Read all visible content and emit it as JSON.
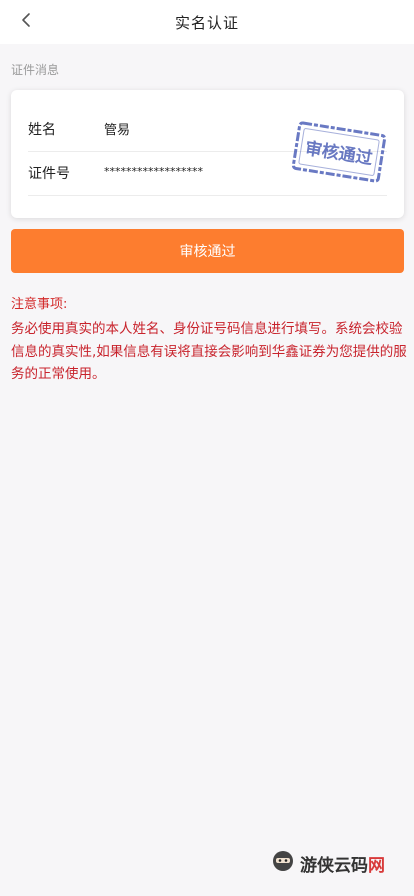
{
  "header": {
    "title": "实名认证",
    "back_icon": "chevron-left-icon"
  },
  "section": {
    "label": "证件消息"
  },
  "card": {
    "rows": [
      {
        "label": "姓名",
        "value": "管易"
      },
      {
        "label": "证件号",
        "value": "******************"
      }
    ],
    "stamp_text": "审核通过"
  },
  "primary_button": {
    "label": "审核通过",
    "color": "#fd7d2f"
  },
  "notice": {
    "title": "注意事项:",
    "body": "务必使用真实的本人姓名、身份证号码信息进行填写。系统会校验信息的真实性,如果信息有误将直接会影响到华鑫证券为您提供的服务的正常使用。",
    "color": "#c8232c"
  },
  "watermark": {
    "main": "游侠云码",
    "accent": "网"
  }
}
